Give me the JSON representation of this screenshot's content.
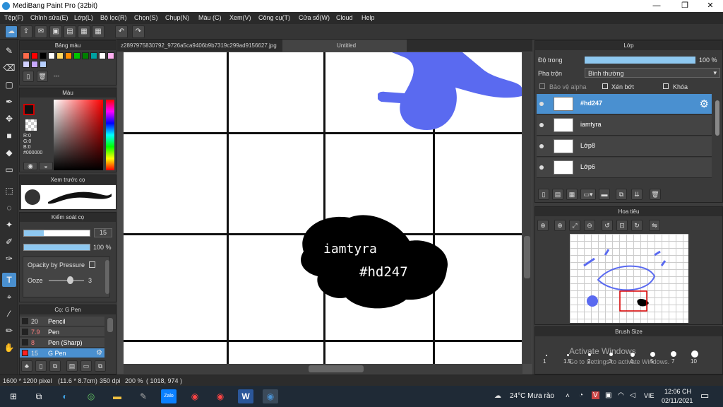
{
  "window": {
    "title": "MediBang Paint Pro (32bit)",
    "minimize": "—",
    "maximize": "❐",
    "close": "✕"
  },
  "menu": [
    "Tệp(F)",
    "Chỉnh sửa(E)",
    "Lớp(L)",
    "Bộ lọc(R)",
    "Chọn(S)",
    "Chụp(N)",
    "Màu (C)",
    "Xem(V)",
    "Công cụ(T)",
    "Cửa sổ(W)",
    "Cloud",
    "Help"
  ],
  "toolbar_icons": [
    "cloud-icon",
    "share-icon",
    "comment-icon",
    "image-icon",
    "document-icon",
    "panel-icon",
    "grid-icon",
    "undo-icon",
    "redo-icon"
  ],
  "palette": {
    "title": "Bảng màu",
    "colors": [
      "#ff6a4a",
      "#ff0000",
      "#000000",
      "#ffffff",
      "#ffd966",
      "#ff8c00",
      "#00c400",
      "#008000",
      "#00a0a0",
      "#ffffff",
      "#ffb0f0",
      "#d0d0ff",
      "#c8a8ff",
      "#b8d0ff"
    ],
    "extra_label": "---"
  },
  "color_panel": {
    "title": "Màu",
    "r": "R:0",
    "g": "G:0",
    "b": "B:0",
    "hex": "#000000",
    "primary": "#cc0000"
  },
  "brush_preview": {
    "title": "Xem trước cọ"
  },
  "brush_control": {
    "title": "Kiểm soát cọ",
    "size": "15",
    "opacity": "100 %",
    "opacity_pressure": "Opacity by Pressure",
    "ooze_label": "Ooze",
    "ooze_value": "3"
  },
  "brush_list": {
    "title": "Cọ: G Pen",
    "items": [
      {
        "size": "20",
        "name": "Pencil",
        "color": "#222222"
      },
      {
        "size": "7.9",
        "name": "Pen",
        "color": "#222222"
      },
      {
        "size": "8",
        "name": "Pen (Sharp)",
        "color": "#222222"
      },
      {
        "size": "15",
        "name": "G Pen",
        "color": "#ff2020"
      }
    ]
  },
  "tabs": {
    "file": "z2897975830792_9726a5ca9406b9b7319c299ad9156627.jpg",
    "untitled": "Untitled"
  },
  "canvas": {
    "text1": "iamtyra",
    "text2": "#hd247"
  },
  "layers": {
    "title": "Lớp",
    "opacity_label": "Độ trong",
    "opacity_value": "100 %",
    "blend_label": "Pha trộn",
    "blend_value": "Bình thường",
    "protect_alpha": "Bảo vệ alpha",
    "clipping": "Xén bớt",
    "lock": "Khóa",
    "items": [
      {
        "name": "#hd247",
        "active": true
      },
      {
        "name": "iamtyra",
        "active": false
      },
      {
        "name": "Lớp8",
        "active": false
      },
      {
        "name": "Lớp6",
        "active": false
      }
    ]
  },
  "navigator": {
    "title": "Hoa tiêu"
  },
  "brush_size": {
    "title": "Brush Size",
    "labels": [
      "1",
      "1.5",
      "2",
      "3",
      "4",
      "5",
      "7",
      "10"
    ],
    "watermark1": "Activate Windows",
    "watermark2": "Go to Settings to activate Windows."
  },
  "status": {
    "size": "1600 * 1200 pixel",
    "cm": "(11.6 * 8.7cm)",
    "dpi": "350 dpi",
    "zoom": "200 %",
    "coords": "( 1018, 974 )"
  },
  "taskbar": {
    "weather": "24°C  Mưa rào",
    "lang": "VIE",
    "time": "12:06 CH",
    "date": "02/11/2021"
  },
  "colors": {
    "accent": "#4a90d0",
    "shape_blue": "#5a6af0"
  }
}
